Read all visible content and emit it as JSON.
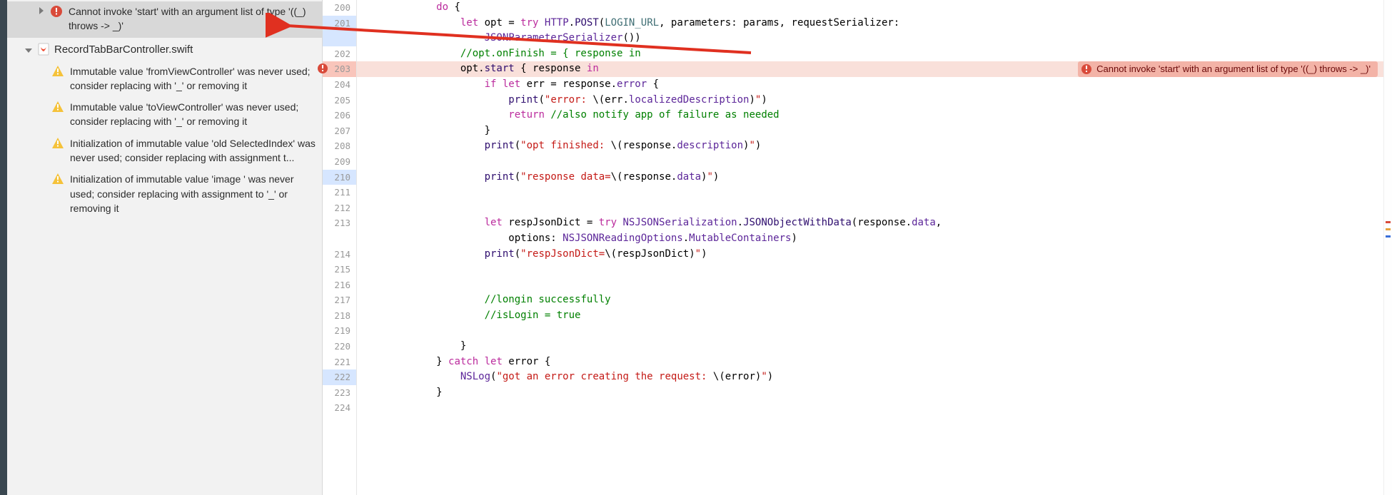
{
  "sidebar": {
    "topError": "Cannot invoke 'start' with an argument list of type '((_) throws -> _)'",
    "fileName": "RecordTabBarController.swift",
    "warnings": [
      "Immutable value 'fromViewController' was never used; consider replacing with '_' or removing it",
      "Immutable value 'toViewController' was never used; consider replacing with '_' or removing it",
      "Initialization of immutable value 'old SelectedIndex' was never used; consider replacing with assignment t...",
      "Initialization of immutable value 'image ' was never used; consider replacing with assignment to '_' or removing it"
    ]
  },
  "editor": {
    "startLine": 200,
    "endLine": 224,
    "errorLine": 203,
    "blueLines": [
      201,
      210,
      222
    ],
    "inlineError": "Cannot invoke 'start' with an argument list of type '((_) throws -> _)'"
  },
  "code": {
    "l200": {
      "indent": "            ",
      "t": "do {"
    },
    "l201": {
      "indent": "                ",
      "pre": "let opt = try ",
      "type": "HTTP",
      "dot": ".",
      "fn": "POST",
      "args1": "(",
      "id": "LOGIN_URL",
      "args2": ", parameters: params, requestSerializer:"
    },
    "l201b": {
      "indent": "                    ",
      "type": "JSONParameterSerializer",
      "rest": "())"
    },
    "l202": {
      "indent": "                ",
      "c": "//opt.onFinish = { response in"
    },
    "l203": {
      "indent": "                ",
      "a": "opt.",
      "b": "start",
      "c": " { response ",
      "d": "in"
    },
    "l204": {
      "indent": "                    ",
      "a": "if let",
      "b": " err = response.",
      "c": "error",
      "d": " {"
    },
    "l205": {
      "indent": "                        ",
      "a": "print",
      "b": "(",
      "s1": "\"error: ",
      "esc": "\\(",
      "expr": "err.",
      "mem": "localizedDescription",
      "s2": ")\"",
      "c": ")"
    },
    "l206": {
      "indent": "                        ",
      "a": "return",
      "c": " //also notify app of failure as needed"
    },
    "l207": {
      "indent": "                    ",
      "t": "}"
    },
    "l208": {
      "indent": "                    ",
      "a": "print",
      "b": "(",
      "s1": "\"opt finished: ",
      "esc": "\\(",
      "expr": "response.",
      "mem": "description",
      "s2": ")\"",
      "c": ")"
    },
    "l210": {
      "indent": "                    ",
      "a": "print",
      "b": "(",
      "s1": "\"response data=",
      "esc": "\\(",
      "expr": "response.",
      "mem": "data",
      "s2": ")\"",
      "c": ")"
    },
    "l213": {
      "indent": "                    ",
      "a": "let",
      "b": " respJsonDict = ",
      "c": "try",
      "d": " ",
      "type": "NSJSONSerialization",
      "dot": ".",
      "fn": "JSONObjectWithData",
      "args": "(response.",
      "mem": "data",
      "rest": ","
    },
    "l213b": {
      "indent": "                        ",
      "a": "options: ",
      "type": "NSJSONReadingOptions",
      "dot": ".",
      "mem": "MutableContainers",
      "rest": ")"
    },
    "l214": {
      "indent": "                    ",
      "a": "print",
      "b": "(",
      "s1": "\"respJsonDict=",
      "esc": "\\(",
      "expr": "respJsonDict",
      "s2": ")\"",
      "c": ")"
    },
    "l217": {
      "indent": "                    ",
      "c": "//longin successfully"
    },
    "l218": {
      "indent": "                    ",
      "c": "//isLogin = true"
    },
    "l220": {
      "indent": "                ",
      "t": "}"
    },
    "l221": {
      "indent": "            ",
      "a": "} ",
      "b": "catch let",
      "c": " error {"
    },
    "l222": {
      "indent": "                ",
      "a": "NSLog",
      "b": "(",
      "s1": "\"got an error creating the request: ",
      "esc": "\\(",
      "expr": "error",
      "s2": ")\"",
      "c": ")"
    },
    "l223": {
      "indent": "            ",
      "t": "}"
    }
  }
}
